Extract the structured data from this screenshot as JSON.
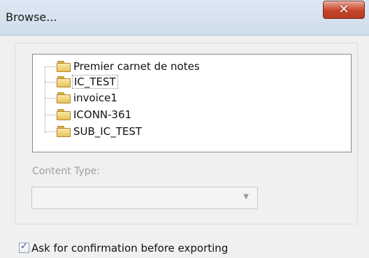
{
  "window": {
    "title": "Browse...",
    "close_icon": "close-icon"
  },
  "tree": {
    "items": [
      {
        "label": "Premier carnet de notes",
        "icon": "folder-icon"
      },
      {
        "label": "IC_TEST",
        "icon": "folder-icon",
        "selected": true
      },
      {
        "label": "invoice1",
        "icon": "folder-icon"
      },
      {
        "label": "ICONN-361",
        "icon": "folder-icon"
      },
      {
        "label": "SUB_IC_TEST",
        "icon": "folder-icon"
      }
    ]
  },
  "content_type": {
    "label": "Content Type:",
    "value": "",
    "disabled": true
  },
  "confirm_export": {
    "label": "Ask for confirmation before exporting",
    "checked": true
  },
  "colors": {
    "close_button": "#c7442b",
    "titlebar": "#dde8f3",
    "folder": "#e9c25a"
  }
}
